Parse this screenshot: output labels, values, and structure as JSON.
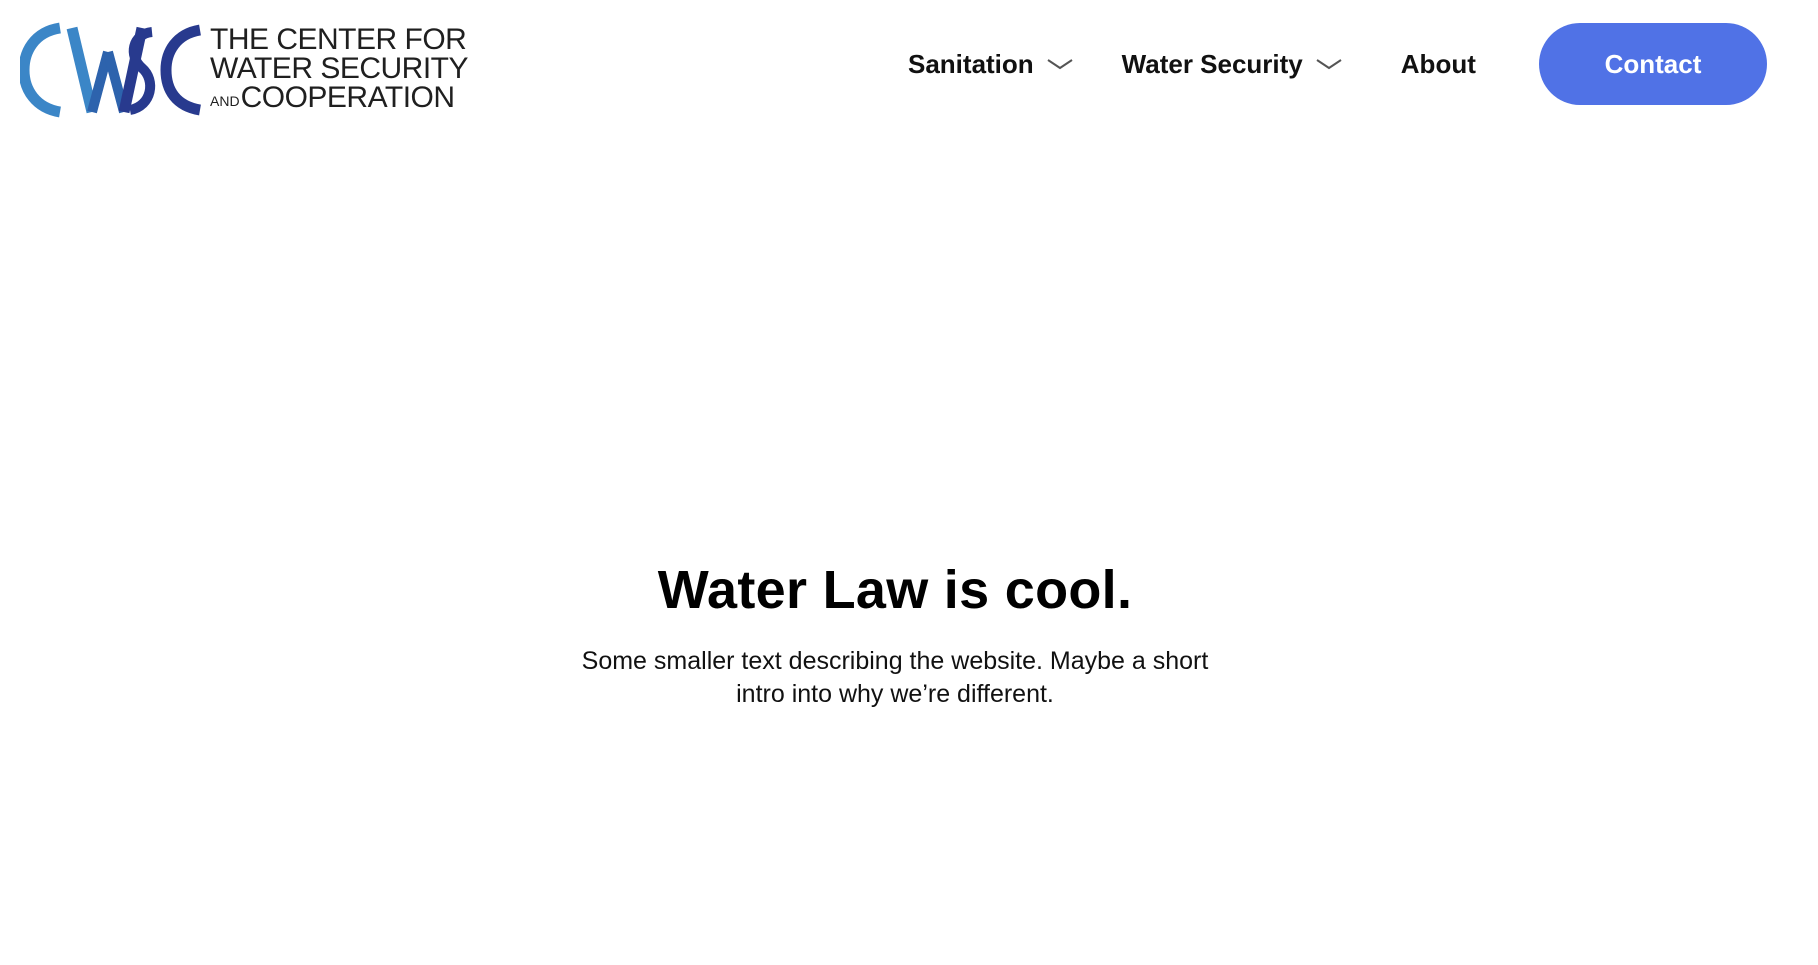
{
  "brand": {
    "logo_line1": "THE CENTER FOR",
    "logo_line2": "WATER SECURITY",
    "logo_and": "AND",
    "logo_line3": "COOPERATION",
    "logo_mark_letters": "CWSC",
    "colors": {
      "light_blue": "#3b86c7",
      "mid_blue": "#2d63ad",
      "dark_blue": "#283a8e"
    }
  },
  "nav": {
    "items": [
      {
        "label": "Sanitation",
        "has_dropdown": true,
        "icon": "chevron-down-icon"
      },
      {
        "label": "Water Security",
        "has_dropdown": true,
        "icon": "chevron-down-icon"
      },
      {
        "label": "About",
        "has_dropdown": false
      }
    ],
    "contact_label": "Contact",
    "accent_color": "#5072e6"
  },
  "hero": {
    "title": "Water Law is cool.",
    "description": "Some smaller text describing the website. Maybe a short intro into why we’re different."
  }
}
